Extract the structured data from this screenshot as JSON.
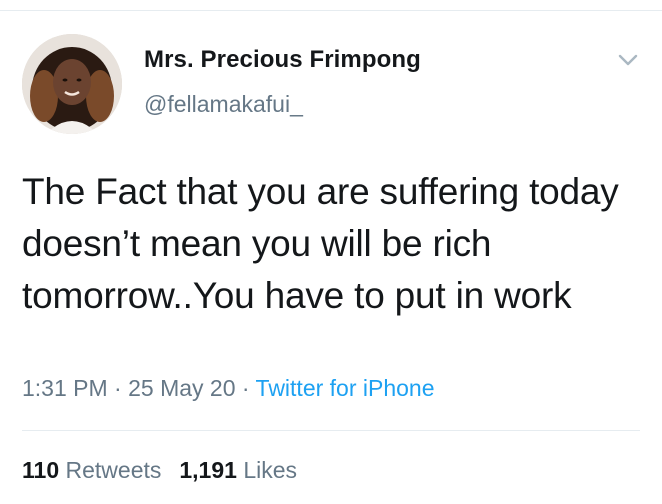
{
  "tweet": {
    "author": {
      "display_name": "Mrs. Precious Frimpong",
      "handle": "@fellamakafui_"
    },
    "text": "The Fact that you are suffering today doesn’t mean you will be rich tomorrow..You have to put in work",
    "meta": {
      "time": "1:31 PM",
      "separator": " · ",
      "date": "25 May 20",
      "source": "Twitter for iPhone"
    },
    "stats": {
      "retweets_count": "110",
      "retweets_label": "Retweets",
      "likes_count": "1,191",
      "likes_label": "Likes"
    }
  },
  "colors": {
    "text_primary": "#14171a",
    "text_secondary": "#657786",
    "link": "#1da1f2",
    "divider": "#e6ecf0"
  },
  "icons": {
    "menu": "chevron-down-icon",
    "avatar": "profile-photo"
  }
}
